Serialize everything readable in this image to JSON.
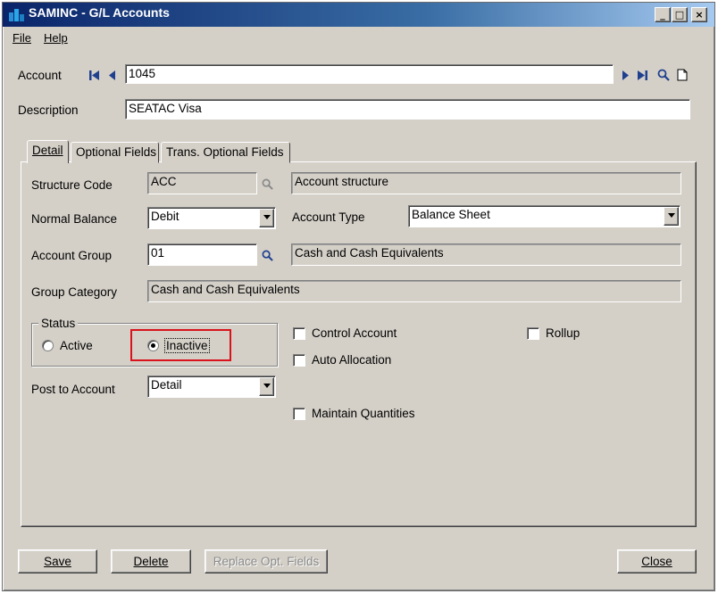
{
  "window": {
    "title": "SAMINC - G/L Accounts"
  },
  "menu": {
    "file": "File",
    "help": "Help"
  },
  "header": {
    "account_label": "Account",
    "account_value": "1045",
    "description_label": "Description",
    "description_value": "SEATAC Visa"
  },
  "tabs": [
    {
      "label": "Detail"
    },
    {
      "label": "Optional Fields"
    },
    {
      "label": "Trans. Optional Fields"
    }
  ],
  "detail": {
    "structure_code_label": "Structure Code",
    "structure_code_value": "ACC",
    "structure_code_desc": "Account structure",
    "normal_balance_label": "Normal Balance",
    "normal_balance_value": "Debit",
    "account_type_label": "Account Type",
    "account_type_value": "Balance Sheet",
    "account_group_label": "Account Group",
    "account_group_value": "01",
    "account_group_desc": "Cash and Cash Equivalents",
    "group_category_label": "Group Category",
    "group_category_value": "Cash and Cash Equivalents",
    "status_label": "Status",
    "status_active": "Active",
    "status_inactive": "Inactive",
    "status_selected": "Inactive",
    "control_account": "Control Account",
    "auto_allocation": "Auto Allocation",
    "maintain_quantities": "Maintain Quantities",
    "rollup": "Rollup",
    "post_to_account_label": "Post to Account",
    "post_to_account_value": "Detail"
  },
  "buttons": {
    "save": "Save",
    "delete": "Delete",
    "replace": "Replace Opt. Fields",
    "close": "Close"
  },
  "colors": {
    "titlebar_start": "#0a246a",
    "highlight": "#d9121b",
    "face": "#d4d0c8"
  }
}
